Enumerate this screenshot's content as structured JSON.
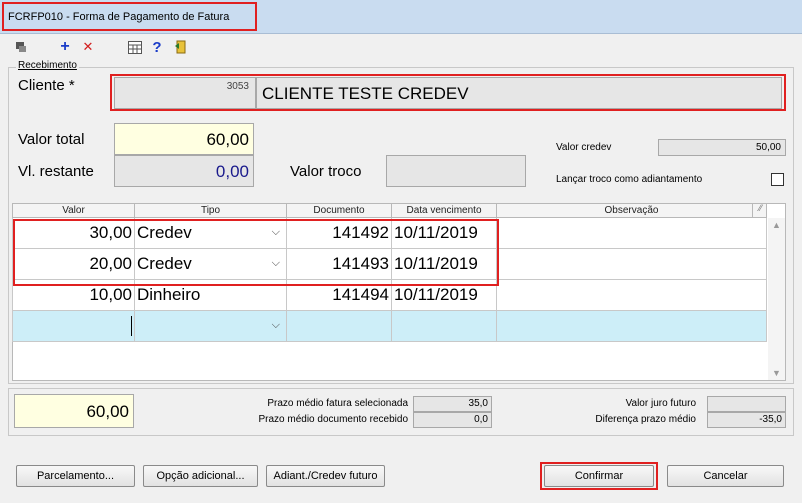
{
  "window": {
    "title": "FCRFP010 - Forma de Pagamento de Fatura"
  },
  "toolbar": {
    "icons": [
      "filter-icon",
      "add-icon",
      "delete-icon",
      "calendar-grid-icon",
      "help-icon",
      "exit-icon"
    ],
    "add_glyph": "+",
    "delete_glyph": "✕",
    "help_glyph": "?"
  },
  "recebimento": {
    "section_label": "Recebimento",
    "cliente_label": "Cliente *",
    "cliente_code": "3053",
    "cliente_name": "CLIENTE TESTE CREDEV",
    "valor_total_label": "Valor total",
    "valor_total": "60,00",
    "vl_restante_label": "Vl. restante",
    "vl_restante": "0,00",
    "valor_troco_label": "Valor troco",
    "valor_troco": "",
    "valor_credev_label": "Valor credev",
    "valor_credev": "50,00",
    "lancar_troco_label": "Lançar troco como adiantamento"
  },
  "grid": {
    "headers": [
      "Valor",
      "Tipo",
      "Documento",
      "Data vencimento",
      "Observação"
    ],
    "rows": [
      {
        "valor": "30,00",
        "tipo": "Credev",
        "documento": "141492",
        "data": "10/11/2019",
        "obs": ""
      },
      {
        "valor": "20,00",
        "tipo": "Credev",
        "documento": "141493",
        "data": "10/11/2019",
        "obs": ""
      },
      {
        "valor": "10,00",
        "tipo": "Dinheiro",
        "documento": "141494",
        "data": "10/11/2019",
        "obs": ""
      }
    ]
  },
  "summary": {
    "total": "60,00",
    "prazo_fatura_label": "Prazo médio fatura selecionada",
    "prazo_fatura": "35,0",
    "prazo_doc_label": "Prazo médio documento recebido",
    "prazo_doc": "0,0",
    "juro_futuro_label": "Valor juro futuro",
    "juro_futuro": "",
    "diferenca_label": "Diferença prazo médio",
    "diferenca": "-35,0"
  },
  "buttons": {
    "parcelamento": "Parcelamento...",
    "opcao": "Opção adicional...",
    "adiant": "Adiant./Credev futuro",
    "confirmar": "Confirmar",
    "cancelar": "Cancelar"
  },
  "colors": {
    "highlight": "#e02020",
    "yellow_field": "#ffffe1",
    "new_row": "#cdeef8",
    "restante_text": "#1a1a8c"
  }
}
